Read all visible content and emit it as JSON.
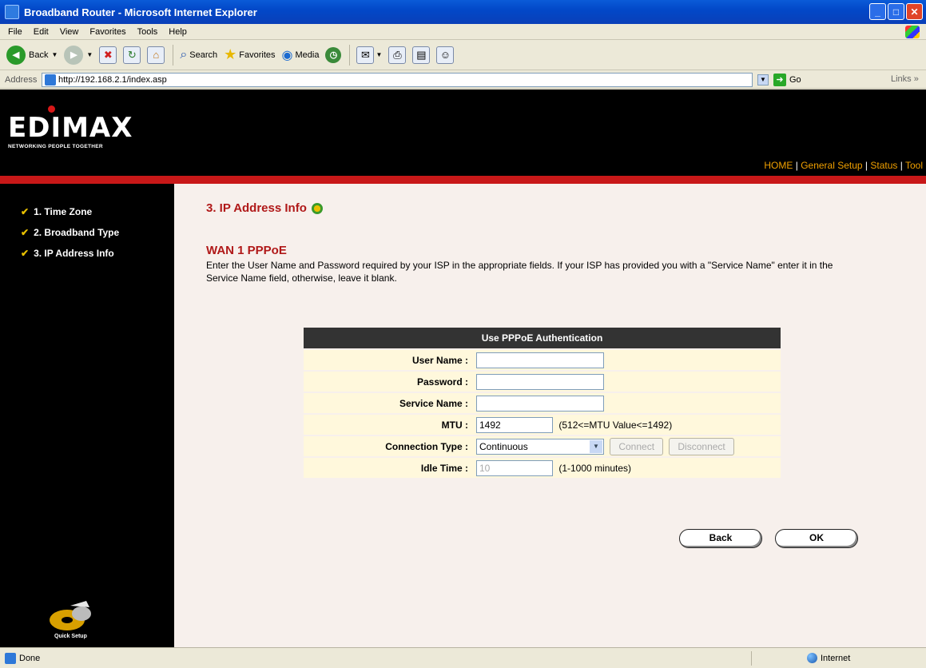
{
  "window": {
    "title": "Broadband Router - Microsoft Internet Explorer",
    "min": "_",
    "max": "□",
    "close": "✕"
  },
  "menu": [
    "File",
    "Edit",
    "View",
    "Favorites",
    "Tools",
    "Help"
  ],
  "toolbar": {
    "back": "Back",
    "search": "Search",
    "favorites": "Favorites",
    "media": "Media"
  },
  "address": {
    "label": "Address",
    "url": "http://192.168.2.1/index.asp",
    "go": "Go",
    "links": "Links »"
  },
  "brand": {
    "logo": "EDIMAX",
    "tagline": "NETWORKING PEOPLE TOGETHER",
    "nav": [
      "HOME",
      "General Setup",
      "Status",
      "Tool"
    ]
  },
  "sidebar": {
    "items": [
      "1. Time Zone",
      "2. Broadband Type",
      "3. IP Address Info"
    ],
    "quick_setup": "Quick Setup"
  },
  "main": {
    "section_title": "3. IP Address Info",
    "wan_title": "WAN 1 PPPoE",
    "description": "Enter the User Name and Password required by your ISP in the appropriate fields. If your ISP has provided you with a \"Service Name\" enter it in the Service Name field, otherwise, leave it blank.",
    "form": {
      "header": "Use PPPoE Authentication",
      "user_name_label": "User Name :",
      "user_name_value": "",
      "password_label": "Password :",
      "password_value": "",
      "service_name_label": "Service Name :",
      "service_name_value": "",
      "mtu_label": "MTU :",
      "mtu_value": "1492",
      "mtu_hint": "(512<=MTU Value<=1492)",
      "connection_type_label": "Connection Type :",
      "connection_type_value": "Continuous",
      "connect_label": "Connect",
      "disconnect_label": "Disconnect",
      "idle_time_label": "Idle Time :",
      "idle_time_value": "10",
      "idle_time_hint": "(1-1000 minutes)"
    },
    "back_label": "Back",
    "ok_label": "OK"
  },
  "status": {
    "left": "Done",
    "zone": "Internet"
  }
}
